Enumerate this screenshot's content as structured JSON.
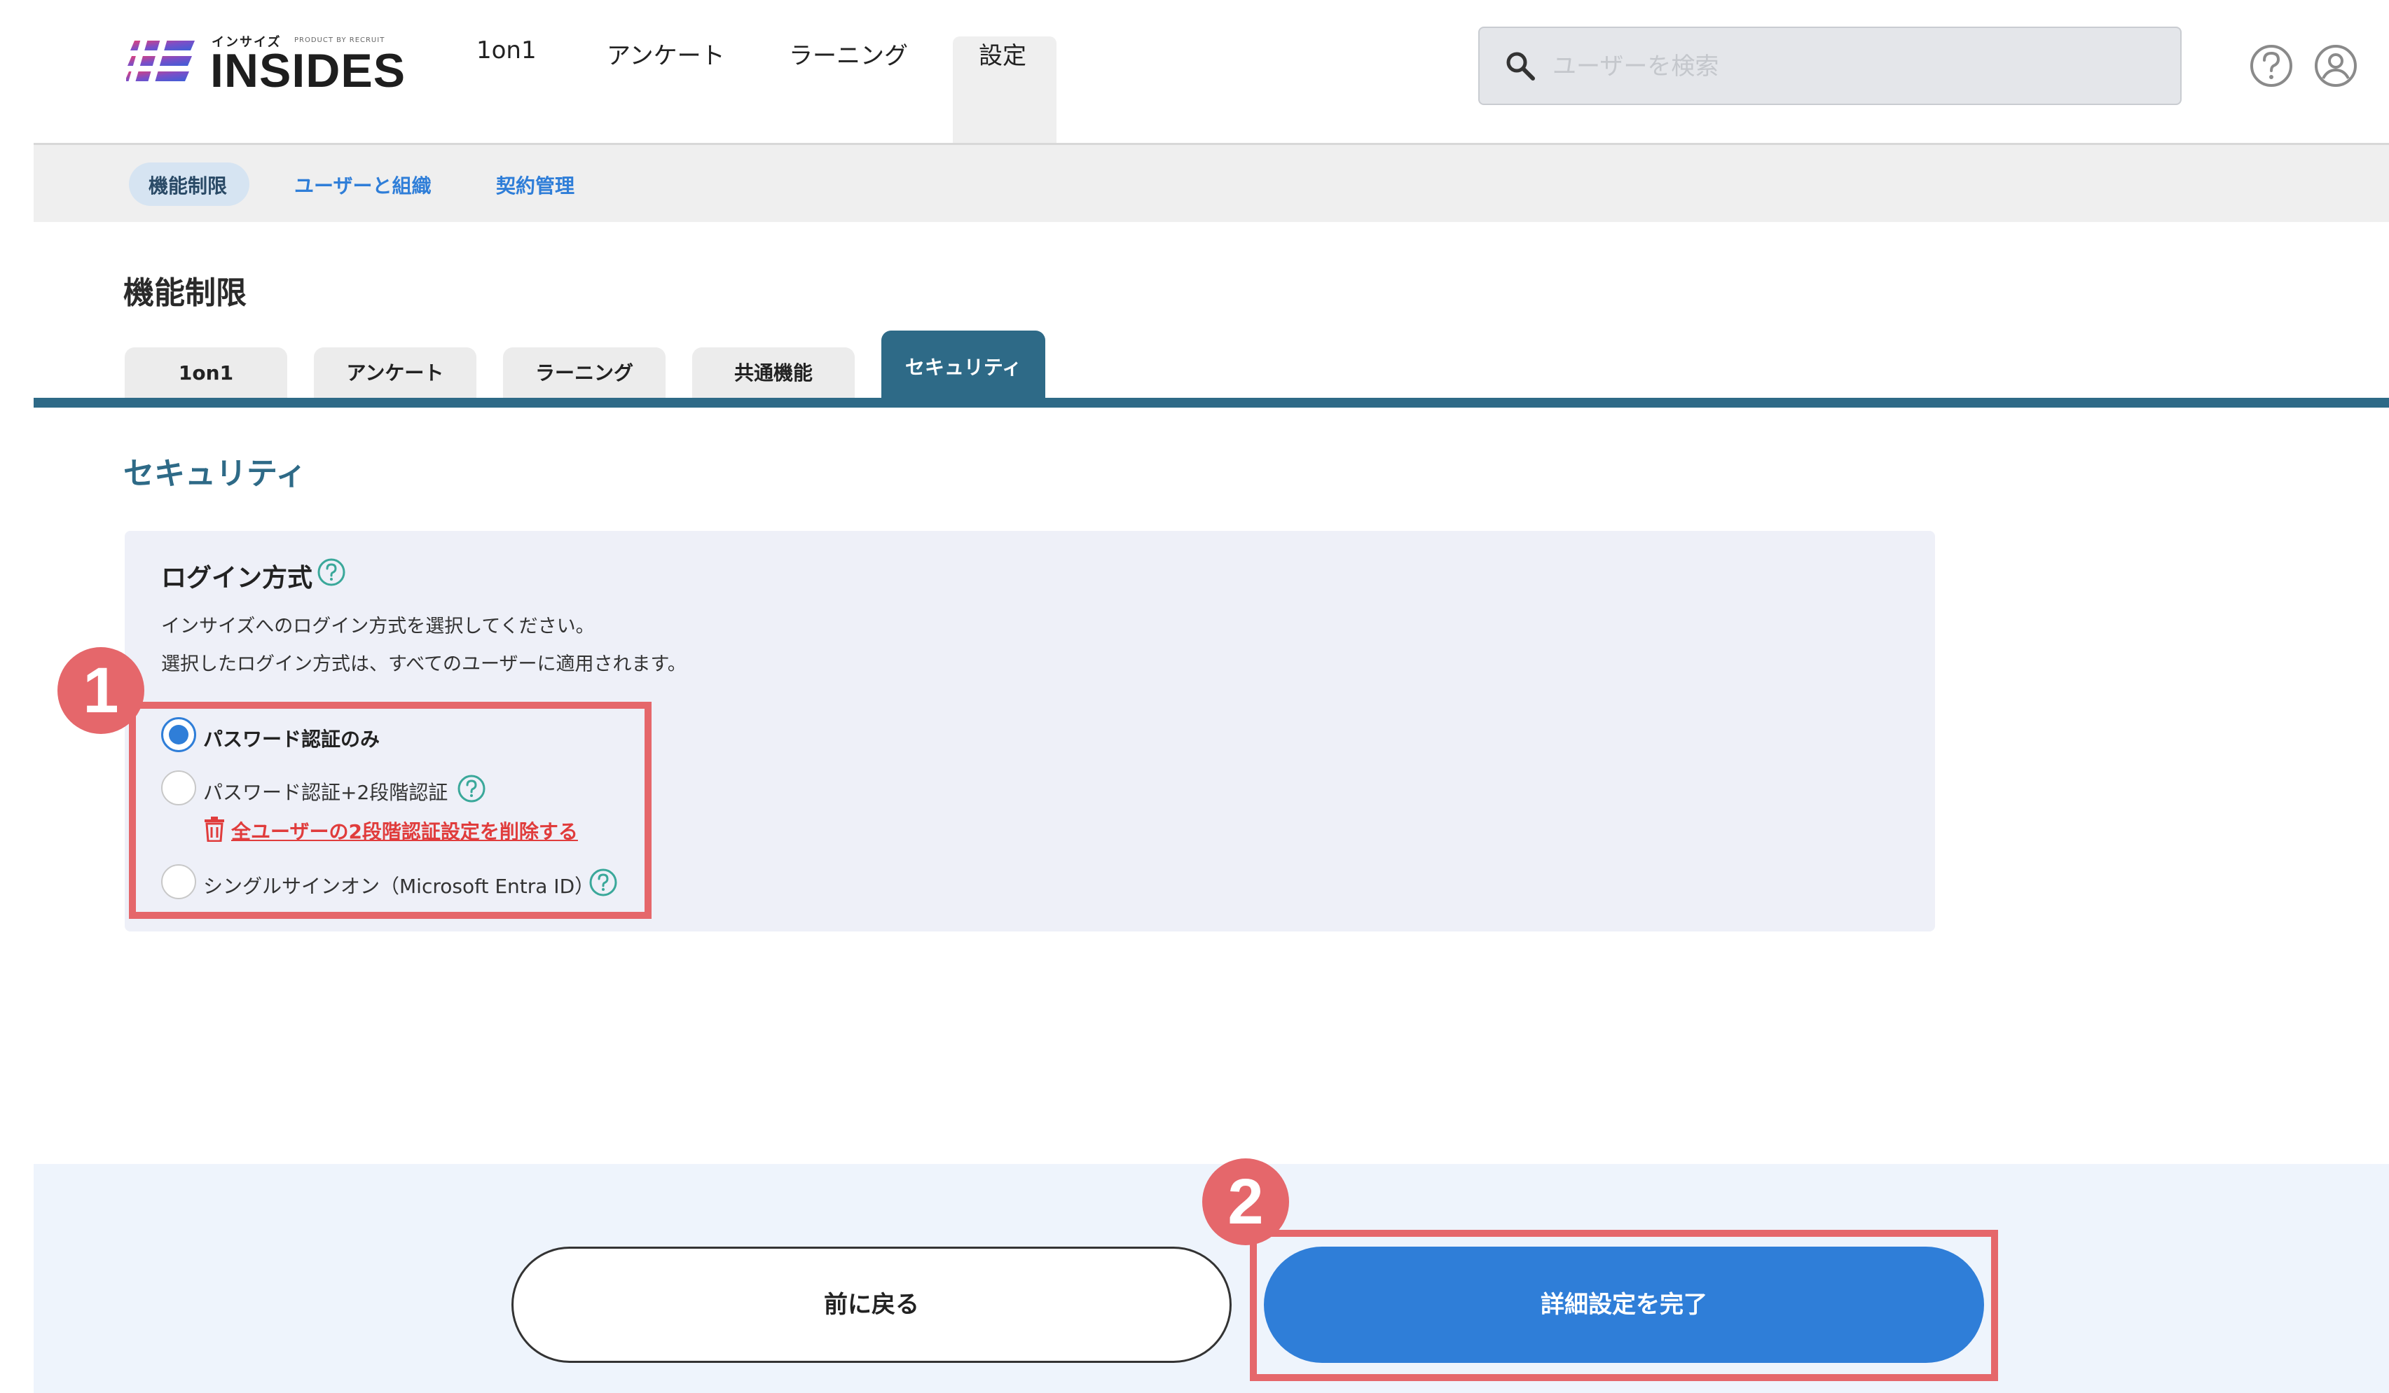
{
  "app": {
    "logo_text": "INSIDES",
    "logo_kana": "インサイズ",
    "logo_by": "PRODUCT BY RECRUIT"
  },
  "top_nav": {
    "items": [
      {
        "label": "1on1"
      },
      {
        "label": "アンケート"
      },
      {
        "label": "ラーニング"
      },
      {
        "label": "設定",
        "active": true
      }
    ],
    "search_placeholder": "ユーザーを検索",
    "help_icon": "help-circle-icon",
    "user_icon": "account-circle-icon"
  },
  "sub_nav": {
    "items": [
      {
        "label": "機能制限",
        "active": true
      },
      {
        "label": "ユーザーと組織"
      },
      {
        "label": "契約管理"
      }
    ]
  },
  "page": {
    "title": "機能制限",
    "tabs": [
      {
        "label": "1on1"
      },
      {
        "label": "アンケート"
      },
      {
        "label": "ラーニング"
      },
      {
        "label": "共通機能"
      },
      {
        "label": "セキュリティ",
        "active": true
      }
    ],
    "section_title": "セキュリティ"
  },
  "login_method": {
    "title": "ログイン方式",
    "desc_line1": "インサイズへのログイン方式を選択してください。",
    "desc_line2": "選択したログイン方式は、すべてのユーザーに適用されます。",
    "options": [
      {
        "label": "パスワード認証のみ",
        "selected": true
      },
      {
        "label": "パスワード認証+2段階認証",
        "selected": false
      },
      {
        "label": "シングルサインオン（Microsoft Entra ID）",
        "selected": false
      }
    ],
    "delete_2fa_link": "全ユーザーの2段階認証設定を削除する"
  },
  "footer": {
    "back_label": "前に戻る",
    "complete_label": "詳細設定を完了"
  },
  "annotations": {
    "step1": "1",
    "step2": "2"
  },
  "colors": {
    "primary": "#2f7ed8",
    "tab_active": "#2e6a87",
    "danger": "#e03c3c",
    "annotation": "#e5676b",
    "help_icon": "#3aa89a"
  }
}
